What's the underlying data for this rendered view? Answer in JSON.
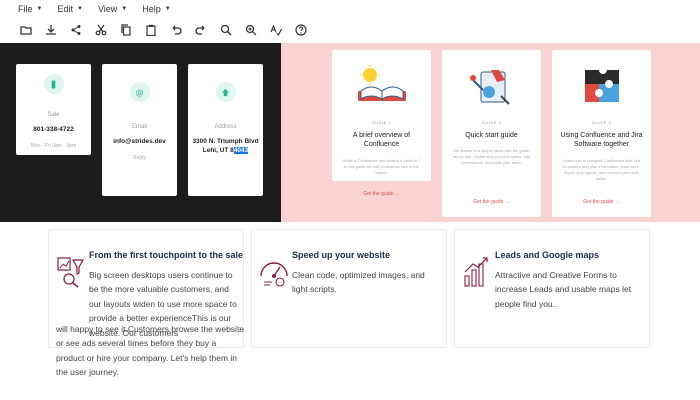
{
  "menu": [
    "File",
    "Edit",
    "View",
    "Help"
  ],
  "toolbar": [
    "folder-open-icon",
    "download-icon",
    "share-icon",
    "cut-icon",
    "copy-icon",
    "paste-icon",
    "undo-icon",
    "redo-icon",
    "zoom-in-icon",
    "zoom-out-icon",
    "spellcheck-icon",
    "help-icon"
  ],
  "contacts": [
    {
      "label": "Sale",
      "value": "801-338-4722",
      "sub": "Mon - Fri 9am - 5pm"
    },
    {
      "label": "Email",
      "value": "info@strides.dev",
      "sub": "Reply"
    },
    {
      "label": "Address",
      "value_a": "3300 N. Triumph Blvd",
      "value_b": "Lehi, UT 8",
      "value_sel": "4043"
    }
  ],
  "guides": [
    {
      "kicker": "GUIDE 1",
      "title": "A brief overview of Confluence",
      "desc": "What is Confluence and what is it used for? In this guide we will Confluence tour to the basics.",
      "link": "Get the guide →"
    },
    {
      "kicker": "GUIDE 2",
      "title": "Quick start guide",
      "desc": "Get started in a simple steps with the guide: set up site. Create and your first space, add permissions, and invite your team.",
      "link": "Get the guide →"
    },
    {
      "kicker": "GUIDE 3",
      "title": "Using Confluence and Jira Software together",
      "desc": "Learn how to integrate Confluence with Jira to capture and plan information, track work, report on progress, and connect your work better.",
      "link": "Get the guide →"
    }
  ],
  "features": [
    {
      "title": "From the first touchpoint to the sale",
      "body": "Big screen desktops users continue to be the more valuable customers, and our layouts widen to use more space to provide a better experienceThis is our website. Our customers"
    },
    {
      "title": "Speed up your website",
      "body": "Clean code, optimized images, and light scripts."
    },
    {
      "title": "Leads and Google maps",
      "body": "Attractive and Creative Forms to increase Leads and usable maps let people find you.."
    }
  ],
  "feature_overflow": "will happy to see it.Customers browse the website or see ads several times before they buy a product or hire your company. Let's help them in the user journey.",
  "colors": {
    "dark_bg": "#1c1c1f",
    "pink_bg": "#fbd3d3",
    "link": "#e0505a",
    "accent_teal": "#dff5ef",
    "icon_maroon": "#8c1c3c",
    "title_navy": "#1d2b47"
  }
}
